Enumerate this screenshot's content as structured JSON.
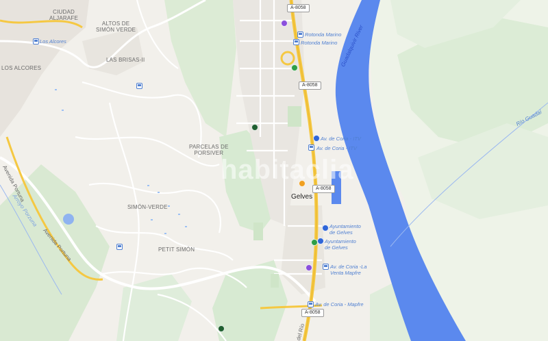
{
  "map": {
    "watermark": "habitaclia",
    "town": "Gelves",
    "colors": {
      "river": "#5b89ee",
      "park": "#d7ead2",
      "road_major": "#f5c842",
      "land": "#f2f0eb"
    },
    "area_labels": {
      "ciudad_aljarafe": "CIUDAD\nALJARAFE",
      "altos_simon_verde": "ALTOS DE\nSIMÓN VERDE",
      "los_alcores_area": "LOS ALCORES",
      "las_brisas": "LAS BRISAS-II",
      "parcelas_porsiver": "PARCELAS DE\nPORSIVER",
      "simon_verde": "SIMÓN-VERDE",
      "petit_simon": "PETIT SIMÓN"
    },
    "bus_stops": {
      "los_alcores": "Los Alcores",
      "rotonda_marino_1": "Rotonda Marino",
      "rotonda_marino_2": "Rotonda Marino",
      "av_coria_itv_1": "Av. de Coria - ITV",
      "av_coria_itv_2": "Av. de Coria - ITV",
      "ayuntamiento_1": "Ayuntamiento\nde Gelves",
      "ayuntamiento_2": "Ayuntamiento\nde Gelves",
      "venta_mapfre": "Av. de Coria -La\nVenta Mapfre",
      "coria_mapfre": "Av. de Coria - Mapfre"
    },
    "roads": {
      "a8058_1": "A-8058",
      "a8058_2": "A-8058",
      "a8058_3": "A-8058",
      "a8058_4": "A-8058",
      "avenida_portuna_1": "Avenida Portuna",
      "avenida_portuna_2": "Avenida Portuna",
      "arroyo_porzuna": "Arroyo Porzuna",
      "del_rio": "del Río"
    },
    "rivers": {
      "guadalquivir": "Guadalquivir River",
      "rio_guadaira": "Río Guadaí"
    },
    "poi_colors": {
      "purple": "#8a4fdc",
      "green": "#2e9e48",
      "dark_green": "#1f5f30",
      "blue": "#2f66d8",
      "orange": "#f0a020"
    }
  }
}
